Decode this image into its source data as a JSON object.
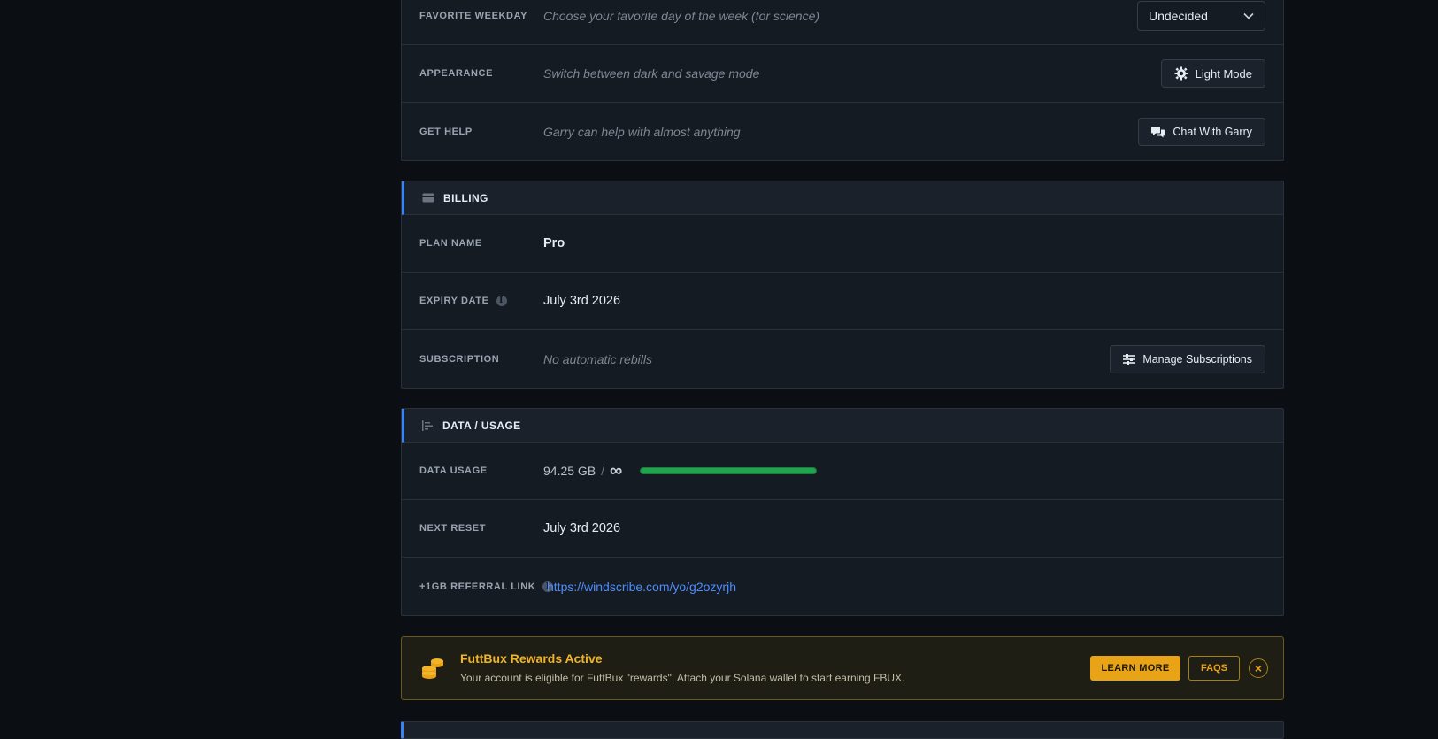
{
  "settings": {
    "favorite_weekday": {
      "label": "FAVORITE WEEKDAY",
      "description": "Choose your favorite day of the week (for science)",
      "selected": "Undecided"
    },
    "appearance": {
      "label": "APPEARANCE",
      "description": "Switch between dark and savage mode",
      "button": "Light Mode"
    },
    "get_help": {
      "label": "GET HELP",
      "description": "Garry can help with almost anything",
      "button": "Chat With Garry"
    }
  },
  "billing": {
    "title": "BILLING",
    "plan_name_label": "PLAN NAME",
    "plan_name": "Pro",
    "expiry_label": "EXPIRY DATE",
    "expiry": "July 3rd 2026",
    "subscription_label": "SUBSCRIPTION",
    "subscription_desc": "No automatic rebills",
    "manage_button": "Manage Subscriptions"
  },
  "usage": {
    "title": "DATA / USAGE",
    "data_usage_label": "DATA USAGE",
    "used": "94.25 GB",
    "separator": "/",
    "limit": "∞",
    "progress_fraction": 1.0,
    "next_reset_label": "NEXT RESET",
    "next_reset": "July 3rd 2026",
    "referral_label": "+1GB REFERRAL LINK",
    "referral_link": "https://windscribe.com/yo/g2ozyrjh"
  },
  "banner": {
    "title": "FuttBux Rewards Active",
    "text": "Your account is eligible for FuttBux \"rewards\". Attach your Solana wallet to start earning FBUX.",
    "learn_more": "LEARN MORE",
    "faqs": "FAQS",
    "close": "×"
  },
  "colors": {
    "accent_blue": "#3b82f6",
    "progress_green": "#22a34f",
    "banner_gold": "#e8a317"
  }
}
